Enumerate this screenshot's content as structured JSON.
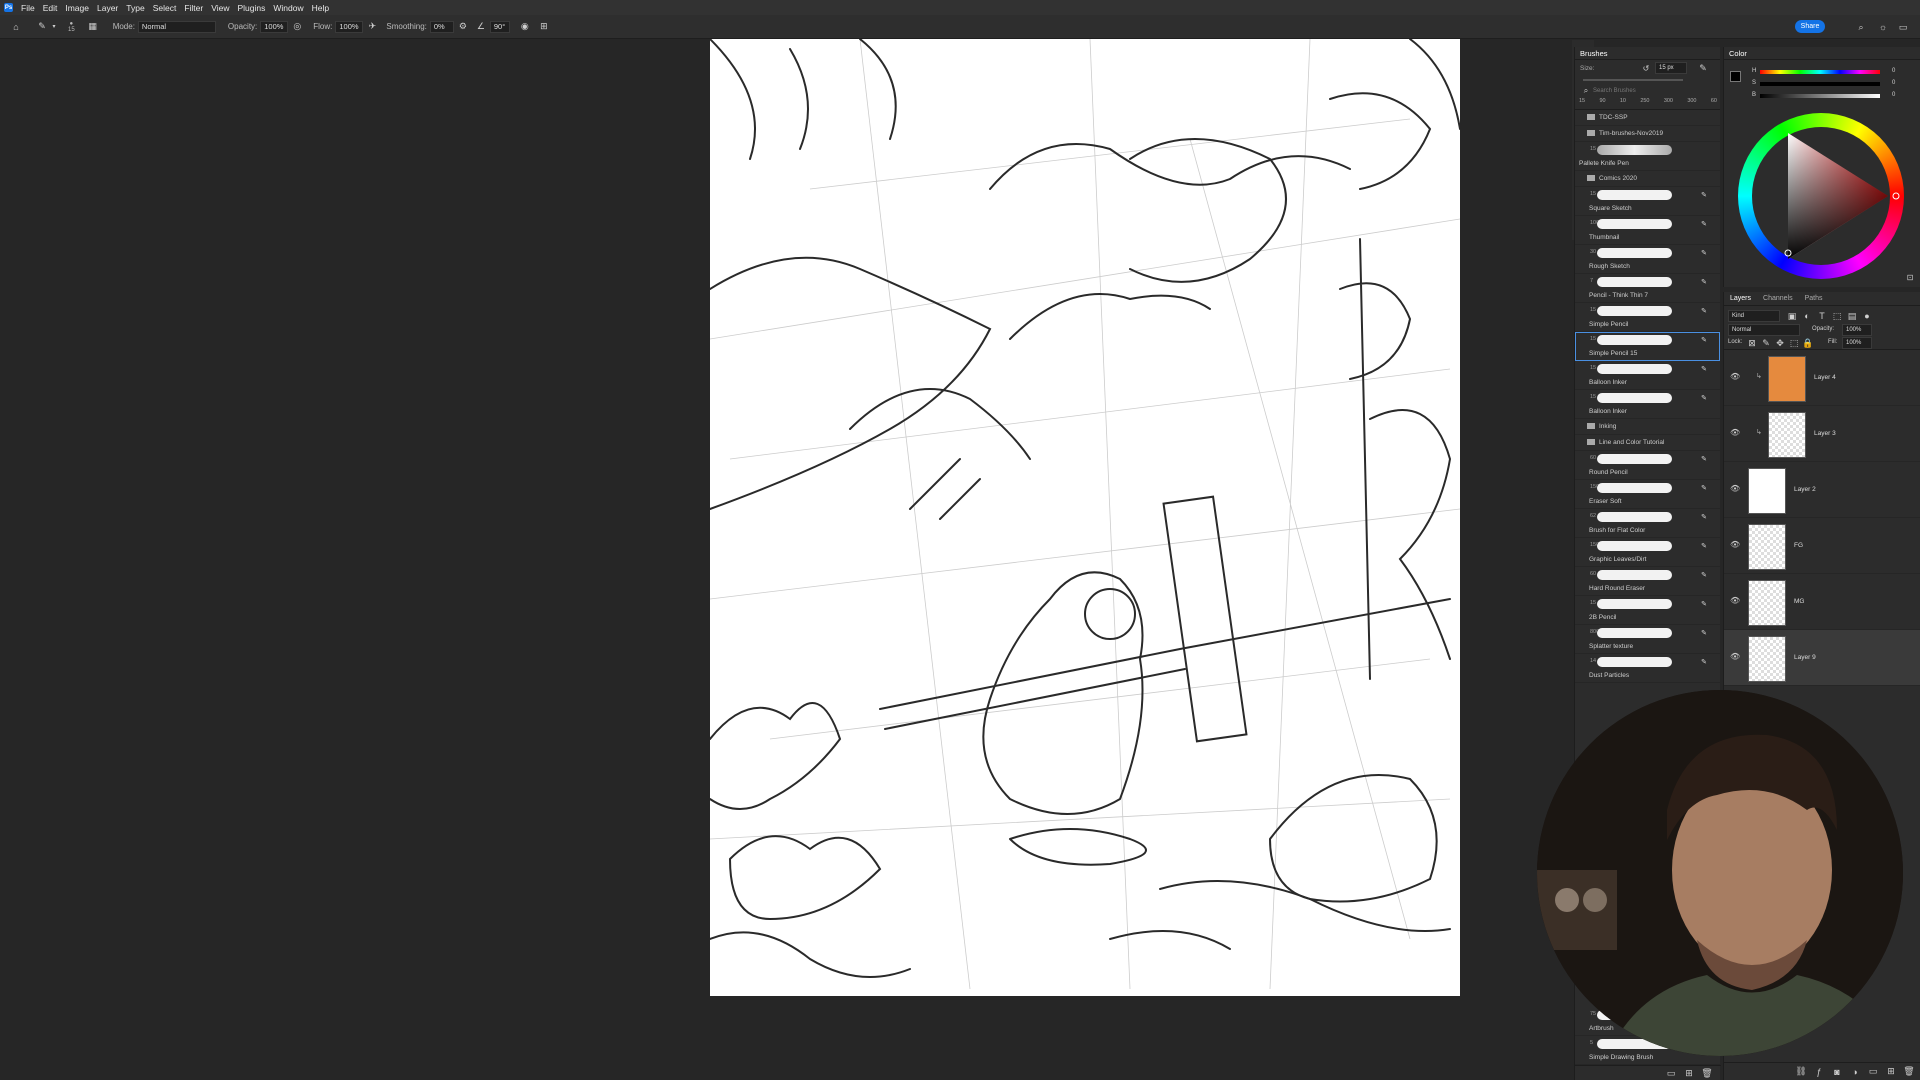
{
  "app": {
    "logo": "Ps"
  },
  "menu": [
    "File",
    "Edit",
    "Image",
    "Layer",
    "Type",
    "Select",
    "Filter",
    "View",
    "Plugins",
    "Window",
    "Help"
  ],
  "options": {
    "brush_size": "15",
    "mode_label": "Mode:",
    "mode_value": "Normal",
    "opacity_label": "Opacity:",
    "opacity_value": "100%",
    "flow_label": "Flow:",
    "flow_value": "100%",
    "smoothing_label": "Smoothing:",
    "smoothing_value": "0%",
    "angle_value": "90°",
    "share_label": "Share"
  },
  "brushes": {
    "tab": "Brushes",
    "size_label": "Size:",
    "size_value": "15 px",
    "search_placeholder": "Search Brushes",
    "preset_sizes": [
      "15",
      "90",
      "10",
      "250",
      "300",
      "300",
      "60"
    ],
    "folders_top": [
      "TDC-SSP",
      "Tim-brushes-Nov2019"
    ],
    "palette_knife": {
      "size": "15",
      "name": "Pallete Knife Pen"
    },
    "comics_folder": "Comics 2020",
    "comics_brushes": [
      {
        "size": "15",
        "name": "Square Sketch"
      },
      {
        "size": "100",
        "name": "Thumbnail"
      },
      {
        "size": "30",
        "name": "Rough Sketch"
      },
      {
        "size": "7",
        "name": "Pencil - Think Thin 7"
      },
      {
        "size": "15",
        "name": "Simple Pencil"
      },
      {
        "size": "15",
        "name": "Simple Pencil 15"
      },
      {
        "size": "15",
        "name": "Balloon Inker"
      },
      {
        "size": "15",
        "name": "Balloon Inker"
      }
    ],
    "inking_folder": "Inking",
    "line_folder": "Line and Color Tutorial",
    "line_brushes": [
      {
        "size": "60",
        "name": "Round Pencil"
      },
      {
        "size": "150",
        "name": "Eraser Soft"
      },
      {
        "size": "62",
        "name": "Brush for Flat Color"
      },
      {
        "size": "150",
        "name": "Graphic Leaves/Dirt"
      },
      {
        "size": "60",
        "name": "Hard Round Eraser"
      },
      {
        "size": "15",
        "name": "2B Pencil"
      },
      {
        "size": "800",
        "name": "Splatter texture"
      },
      {
        "size": "14",
        "name": "Dust Particles"
      }
    ],
    "bottom_brushes": [
      {
        "size": "75",
        "name": "Artbrush"
      },
      {
        "size": "5",
        "name": "Simple Drawing Brush"
      }
    ]
  },
  "color": {
    "tab": "Color",
    "hsb_labels": [
      "H",
      "S",
      "B"
    ],
    "hsb_values": [
      "0",
      "0",
      "0"
    ],
    "accent": "#d22020"
  },
  "layers": {
    "tabs": [
      "Layers",
      "Channels",
      "Paths"
    ],
    "kind_label": "Kind",
    "blend_value": "Normal",
    "opacity_label": "Opacity:",
    "opacity_value": "100%",
    "lock_label": "Lock:",
    "fill_label": "Fill:",
    "fill_value": "100%",
    "items": [
      {
        "name": "Layer 4",
        "fill": "#e58a3e",
        "clip": true
      },
      {
        "name": "Layer 3",
        "fill": "checker",
        "clip": true
      },
      {
        "name": "Layer 2",
        "fill": "#ffffff",
        "clip": false
      },
      {
        "name": "FG",
        "fill": "checker",
        "clip": false
      },
      {
        "name": "MG",
        "fill": "checker",
        "clip": false
      },
      {
        "name": "Layer 9",
        "fill": "checker",
        "clip": false
      }
    ]
  }
}
